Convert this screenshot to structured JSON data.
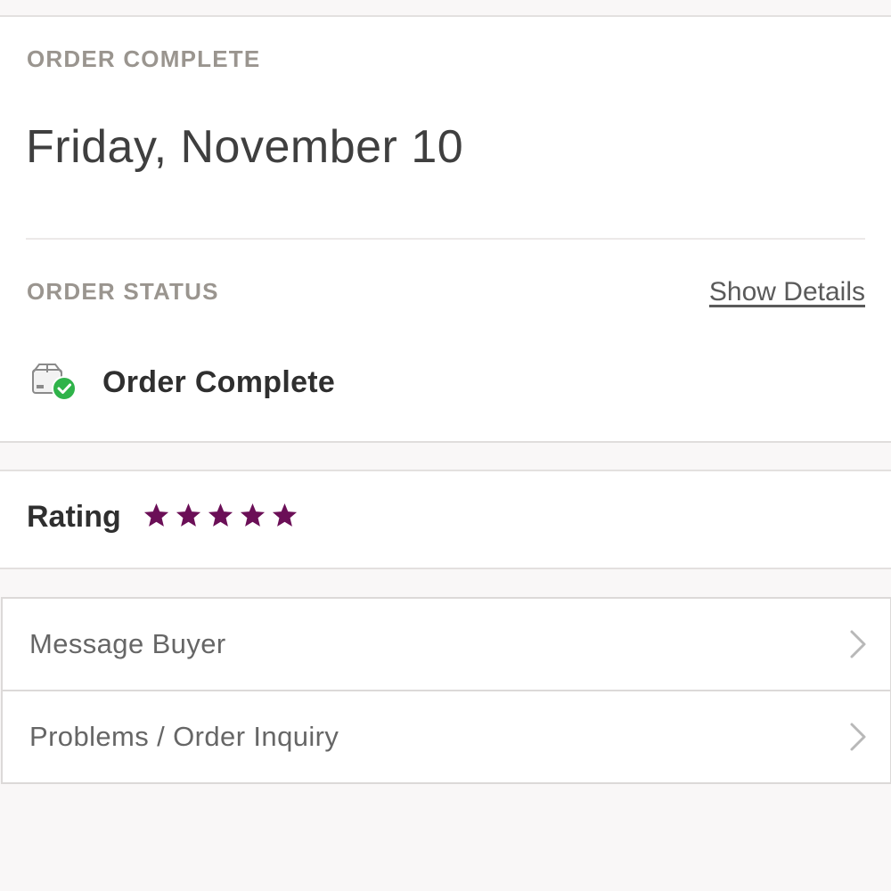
{
  "order": {
    "section_label": "ORDER COMPLETE",
    "date": "Friday, November 10"
  },
  "status": {
    "section_label": "ORDER STATUS",
    "show_details_label": "Show Details",
    "icon": "package-complete-icon",
    "text": "Order Complete"
  },
  "rating": {
    "label": "Rating",
    "stars": 5,
    "max_stars": 5,
    "star_color": "#6b0f57"
  },
  "menu": {
    "items": [
      {
        "label": "Message Buyer",
        "icon": "chevron-right-icon"
      },
      {
        "label": "Problems / Order Inquiry",
        "icon": "chevron-right-icon"
      }
    ]
  },
  "colors": {
    "check_green": "#2fb34a",
    "background": "#f9f7f7"
  }
}
